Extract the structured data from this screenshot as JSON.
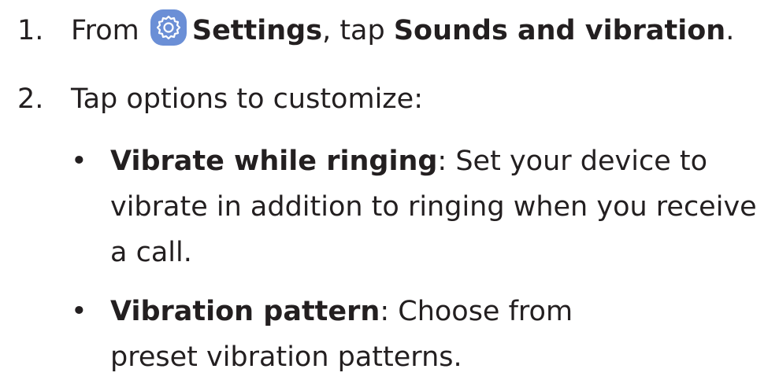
{
  "steps": [
    {
      "number": "1.",
      "prefix": "From",
      "settings_label": "Settings",
      "middle": ", tap ",
      "target_label": "Sounds and vibration",
      "suffix": "."
    },
    {
      "number": "2.",
      "text": "Tap options to customize:"
    }
  ],
  "icons": {
    "settings": "gear-icon",
    "settings_color": "#6b8fd6"
  },
  "options": [
    {
      "bullet": "•",
      "title": "Vibrate while ringing",
      "separator": ": ",
      "description": "Set your device to vibrate in addition to ringing when you receive a call."
    },
    {
      "bullet": "•",
      "title": "Vibration pattern",
      "separator": ": ",
      "description": "Choose from preset vibration patterns."
    }
  ]
}
